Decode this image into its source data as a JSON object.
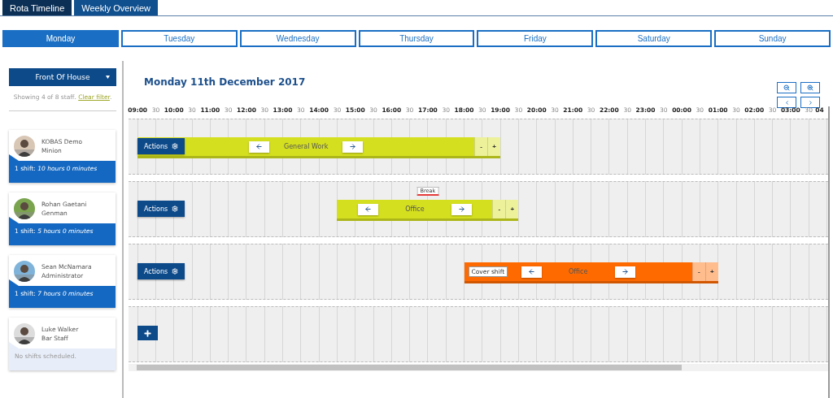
{
  "top_tabs": [
    {
      "label": "Rota Timeline",
      "selected": true
    },
    {
      "label": "Weekly Overview",
      "selected": false
    }
  ],
  "day_tabs": [
    {
      "label": "Monday",
      "selected": true
    },
    {
      "label": "Tuesday",
      "selected": false
    },
    {
      "label": "Wednesday",
      "selected": false
    },
    {
      "label": "Thursday",
      "selected": false
    },
    {
      "label": "Friday",
      "selected": false
    },
    {
      "label": "Saturday",
      "selected": false
    },
    {
      "label": "Sunday",
      "selected": false
    }
  ],
  "department": "Front Of House",
  "filter_note": {
    "text": "Showing 4 of 8 staff.",
    "link": "Clear filter",
    "trailing": "."
  },
  "staff": [
    {
      "kind": "scheduled",
      "name": "KOBAS Demo",
      "role": "Minion",
      "shift_label": "1 shift:",
      "duration": "10 hours 0 minutes"
    },
    {
      "kind": "scheduled",
      "name": "Rohan Gaetani",
      "role": "Genman",
      "shift_label": "1 shift:",
      "duration": "5 hours 0 minutes"
    },
    {
      "kind": "scheduled",
      "name": "Sean McNamara",
      "role": "Administrator",
      "shift_label": "1 shift:",
      "duration": "7 hours 0 minutes"
    },
    {
      "kind": "empty",
      "name": "Luke Walker",
      "role": "Bar Staff",
      "note": "No shifts scheduled."
    }
  ],
  "date_title": "Monday 11th December 2017",
  "timeline_header": [
    "09:00",
    "30",
    "10:00",
    "30",
    "11:00",
    "30",
    "12:00",
    "30",
    "13:00",
    "30",
    "14:00",
    "30",
    "15:00",
    "30",
    "16:00",
    "30",
    "17:00",
    "30",
    "18:00",
    "30",
    "19:00",
    "30",
    "20:00",
    "30",
    "21:00",
    "30",
    "22:00",
    "30",
    "23:00",
    "30",
    "00:00",
    "30",
    "01:00",
    "30",
    "02:00",
    "30",
    "03:00",
    "30",
    "04"
  ],
  "rows": [
    {
      "kind": "shift",
      "actions": "Actions",
      "shift": {
        "name": "General Work",
        "color": "#d4df1f",
        "minus": "-",
        "plus": "+"
      }
    },
    {
      "kind": "shift",
      "actions": "Actions",
      "shift": {
        "name": "Office",
        "color": "#d4df1f",
        "break": "Break",
        "minus": "-",
        "plus": "+"
      }
    },
    {
      "kind": "shift",
      "actions": "Actions",
      "shift": {
        "name": "Office",
        "color": "#ff6a00",
        "tag": "Cover shift",
        "minus": "-",
        "plus": "+"
      }
    },
    {
      "kind": "add"
    }
  ]
}
